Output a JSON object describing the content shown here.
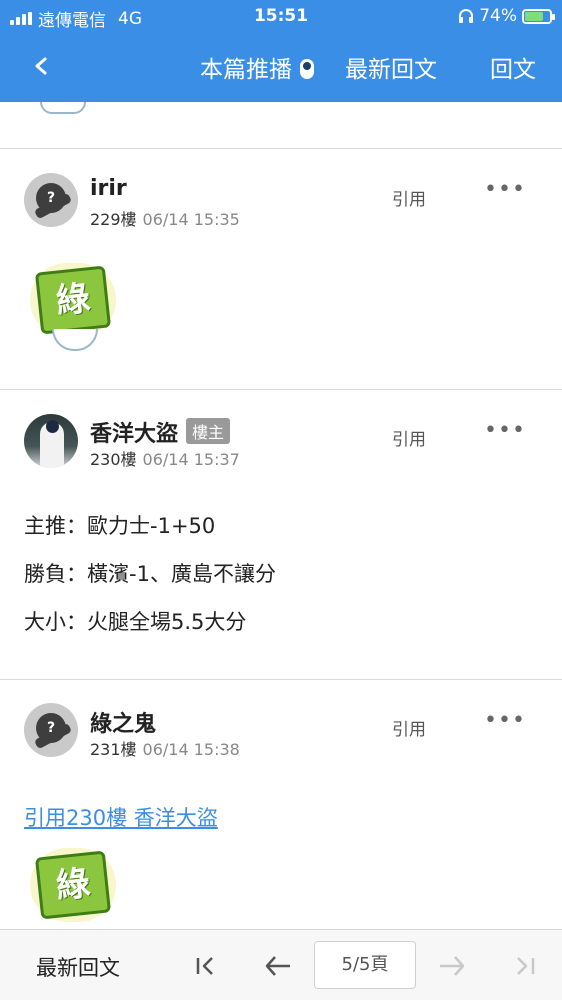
{
  "status_bar": {
    "carrier": "遠傳電信",
    "network": "4G",
    "time": "15:51",
    "battery": "74%",
    "battery_level": 0.74,
    "signal_bars": 4
  },
  "nav": {
    "push_label": "本篇推播",
    "latest_label": "最新回文",
    "reply_label": "回文"
  },
  "posts": [
    {
      "username": "irir",
      "floor": "229樓",
      "time": "06/14 15:35",
      "quote_label": "引用",
      "sticker_text": "綠"
    },
    {
      "username": "香洋大盜",
      "badge": "樓主",
      "floor": "230樓",
      "time": "06/14 15:37",
      "quote_label": "引用",
      "lines": [
        "主推：歐力士-1+50",
        "勝負：橫濱-1、廣島不讓分",
        "大小：火腿全場5.5大分"
      ]
    },
    {
      "username": "綠之鬼",
      "floor": "231樓",
      "time": "06/14 15:38",
      "quote_label": "引用",
      "quote_link": "引用230樓 香洋大盜",
      "sticker_text": "綠"
    }
  ],
  "avatar_placeholder": "?",
  "more_glyph": "•••",
  "bottom_bar": {
    "latest_label": "最新回文",
    "page_indicator": "5/5頁"
  },
  "colors": {
    "accent": "#3a8ee6",
    "link": "#3a8ee6"
  }
}
